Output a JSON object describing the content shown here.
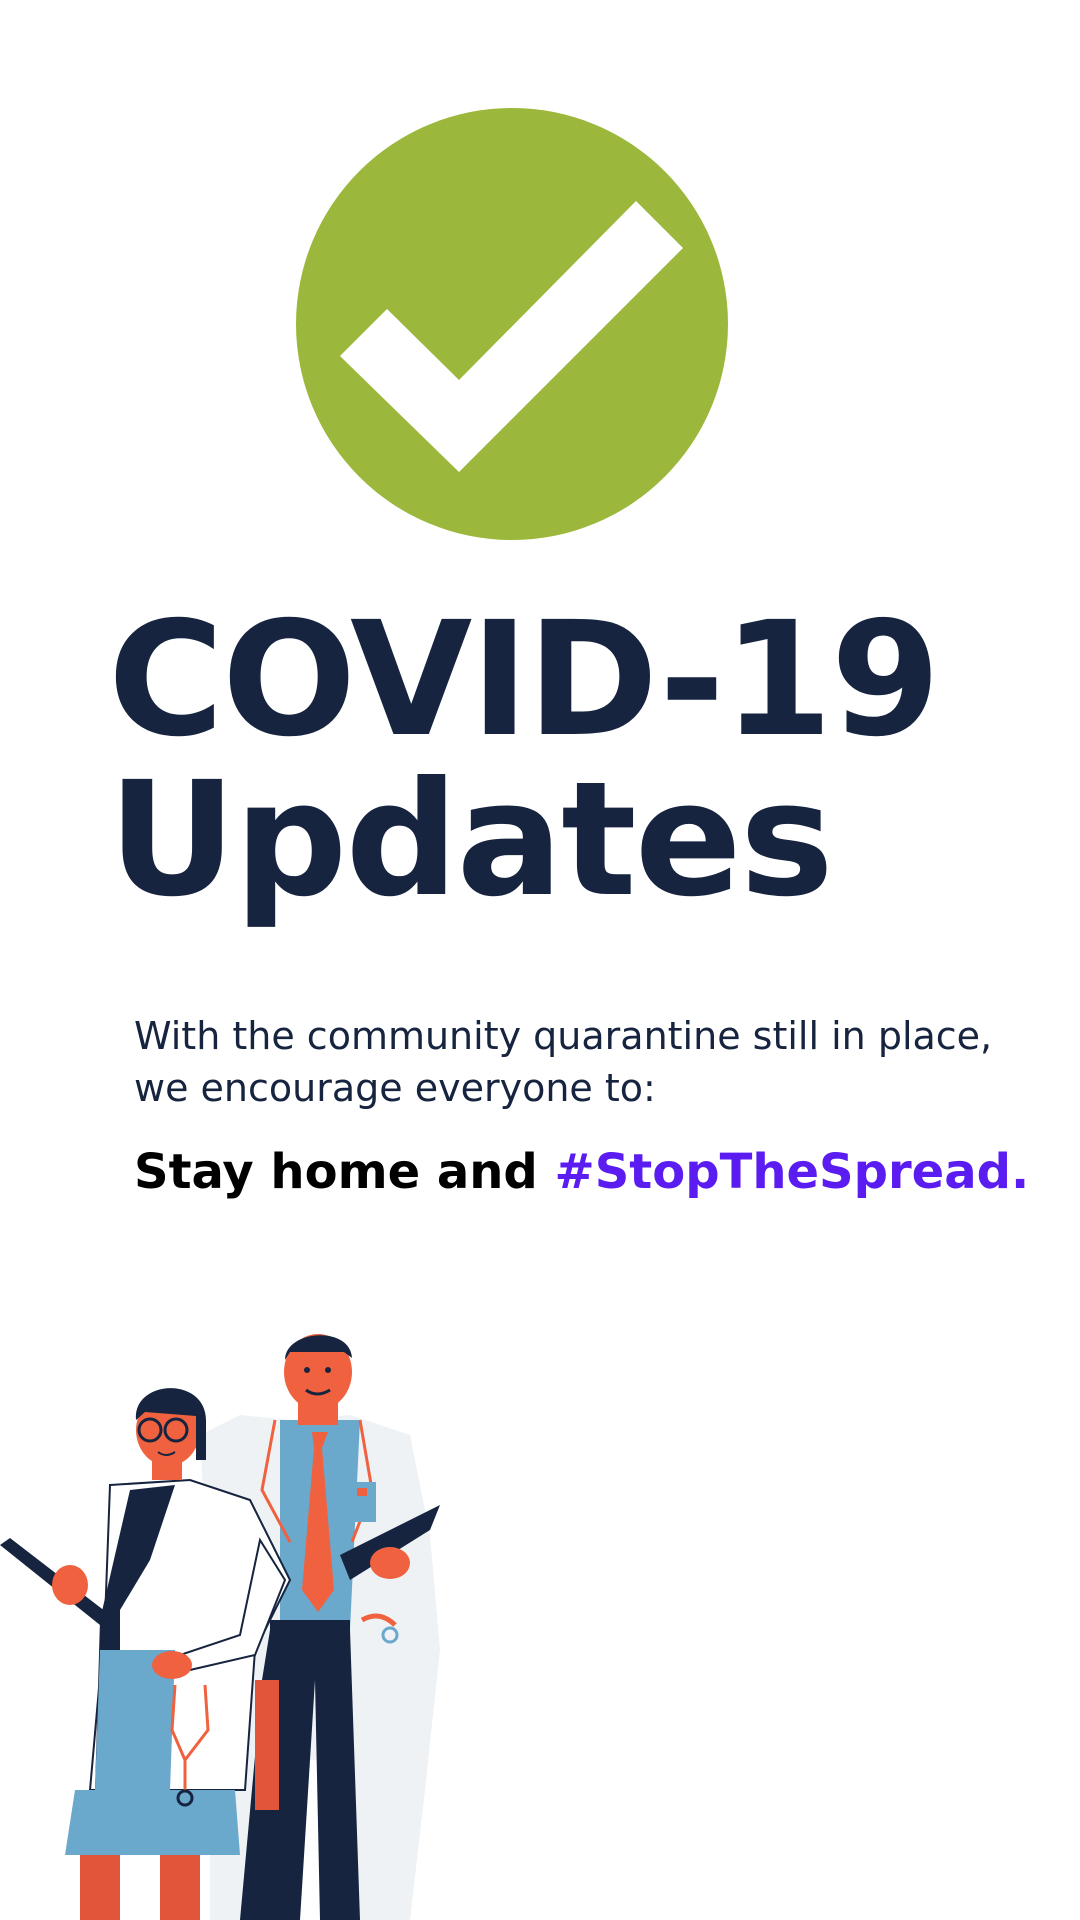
{
  "colors": {
    "check_green": "#9bb83c",
    "title_navy": "#16243f",
    "hashtag_purple": "#5a1cf0",
    "coat_white": "#eef2f5",
    "scrub_blue": "#6aa9cc",
    "accent_red": "#f0623f"
  },
  "icons": {
    "check": "checkmark-circle-icon"
  },
  "title": {
    "line1": "COVID-19",
    "line2": "Updates"
  },
  "message": {
    "line1": "With the community quarantine still in place,",
    "line2": "we encourage everyone to:"
  },
  "cta": {
    "lead": "Stay home and ",
    "hashtag": "#StopTheSpread."
  }
}
